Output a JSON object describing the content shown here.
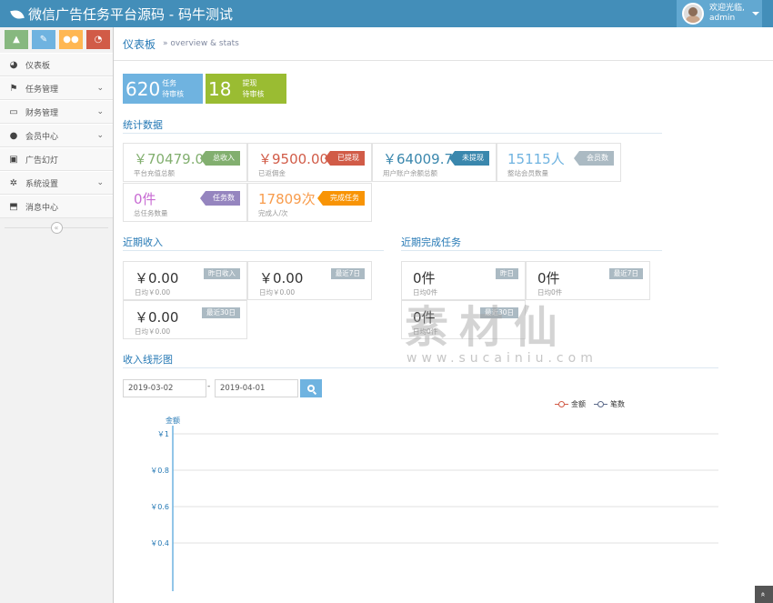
{
  "app": {
    "title": "微信广告任务平台源码 - 码牛测试"
  },
  "user": {
    "greeting": "欢迎光临,",
    "name": "admin"
  },
  "sidebar": {
    "items": [
      {
        "label": "仪表板",
        "icon": "dashboard-icon",
        "has_children": false
      },
      {
        "label": "任务管理",
        "icon": "flag-icon",
        "has_children": true
      },
      {
        "label": "财务管理",
        "icon": "inbox-icon",
        "has_children": true
      },
      {
        "label": "会员中心",
        "icon": "user-icon",
        "has_children": true
      },
      {
        "label": "广告幻灯",
        "icon": "picture-icon",
        "has_children": false
      },
      {
        "label": "系统设置",
        "icon": "cog-icon",
        "has_children": true
      },
      {
        "label": "消息中心",
        "icon": "bookmark-icon",
        "has_children": false
      }
    ],
    "collapse_label": "«"
  },
  "breadcrumb": {
    "title": "仪表板",
    "subtitle": "» overview & stats"
  },
  "top_stats": [
    {
      "value": "620",
      "label1": "任务",
      "label2": "待审核",
      "color": "#6fb3e0"
    },
    {
      "value": "18",
      "label1": "提现",
      "label2": "待审核",
      "color": "#9abc32"
    }
  ],
  "stats_section": {
    "title": "统计数据",
    "boxes": [
      {
        "value": "￥70479.00",
        "sub": "平台充值总额",
        "tag": "总收入",
        "value_color": "#82af6f",
        "tag_color": "green"
      },
      {
        "value": "￥9500.00",
        "sub": "已返佣金",
        "tag": "已提现",
        "value_color": "#d15b47",
        "tag_color": "red"
      },
      {
        "value": "￥64009.75",
        "sub": "用户账户余额总额",
        "tag": "未提现",
        "value_color": "#3a87ad",
        "tag_color": "blue"
      },
      {
        "value": "15115人",
        "sub": "整站会员数量",
        "tag": "会员数",
        "value_color": "#6fb3e0",
        "tag_color": "gray"
      },
      {
        "value": "0件",
        "sub": "总任务数量",
        "tag": "任务数",
        "value_color": "#c86bd3",
        "tag_color": "purple"
      },
      {
        "value": "17809次",
        "sub": "完成人/次",
        "tag": "完成任务",
        "value_color": "#f89c4c",
        "tag_color": "orange"
      }
    ]
  },
  "income_section": {
    "title": "近期收入",
    "boxes": [
      {
        "value": "￥0.00",
        "sub": "日均￥0.00",
        "badge": "昨日收入"
      },
      {
        "value": "￥0.00",
        "sub": "日均￥0.00",
        "badge": "最近7日"
      },
      {
        "value": "￥0.00",
        "sub": "日均￥0.00",
        "badge": "最近30日"
      }
    ]
  },
  "tasks_section": {
    "title": "近期完成任务",
    "boxes": [
      {
        "value": "0件",
        "sub": "日均0件",
        "badge": "昨日"
      },
      {
        "value": "0件",
        "sub": "日均0件",
        "badge": "最近7日"
      },
      {
        "value": "0件",
        "sub": "日均0件",
        "badge": "最近30日"
      }
    ]
  },
  "chart_section": {
    "title": "收入线形图",
    "date_from": "2019-03-02",
    "date_sep": "-",
    "date_to": "2019-04-01"
  },
  "chart_data": {
    "type": "line",
    "ylabel": "金额",
    "ylim": [
      0.4,
      1
    ],
    "yticks": [
      "￥1",
      "￥0.8",
      "￥0.6",
      "￥0.4"
    ],
    "series": [
      {
        "name": "金额",
        "color": "#d15b47",
        "values": []
      },
      {
        "name": "笔数",
        "color": "#5c6a8a",
        "values": []
      }
    ],
    "grid": true
  },
  "watermark": {
    "text": "素材仙",
    "url": "www.sucainiu.com"
  },
  "scroll_top_label": "»"
}
